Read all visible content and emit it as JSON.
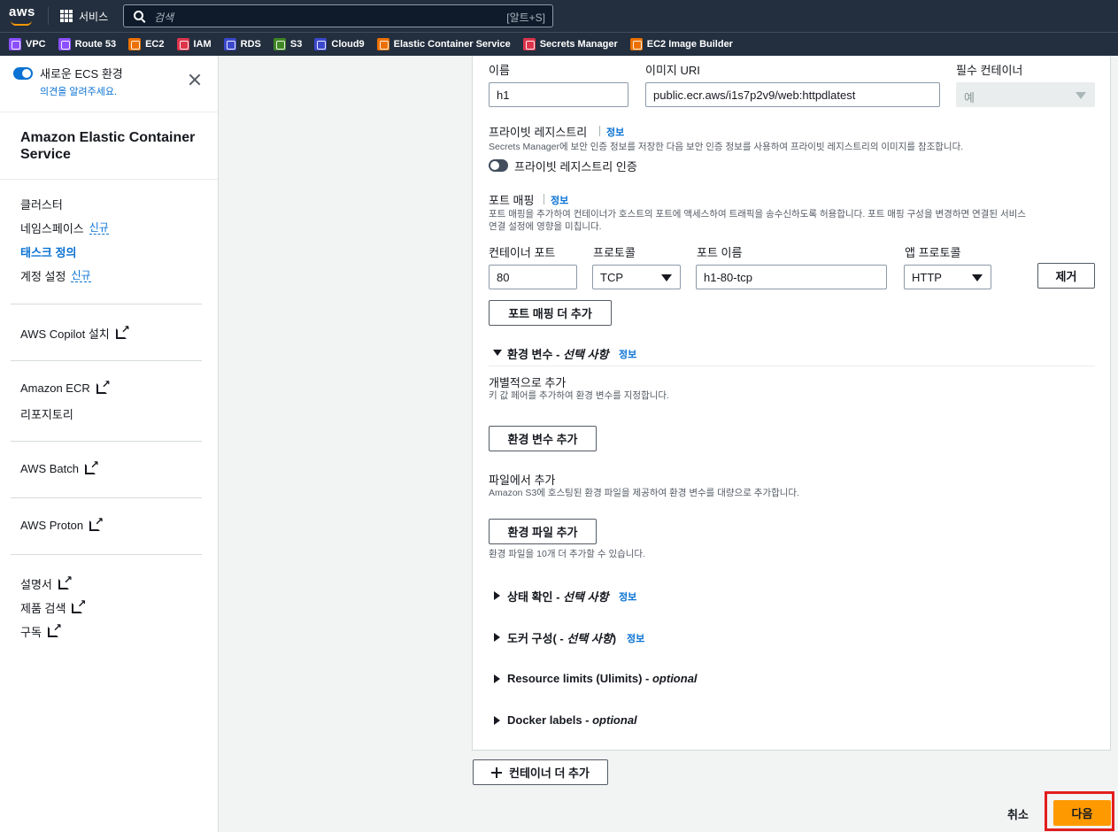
{
  "topnav": {
    "logo": "aws",
    "services_label": "서비스",
    "search_placeholder": "검색",
    "search_shortcut": "[알트+S]"
  },
  "favorites": [
    {
      "label": "VPC",
      "color": "#8c4fff"
    },
    {
      "label": "Route 53",
      "color": "#8c4fff"
    },
    {
      "label": "EC2",
      "color": "#ed7100"
    },
    {
      "label": "IAM",
      "color": "#dd344c"
    },
    {
      "label": "RDS",
      "color": "#3b48cc"
    },
    {
      "label": "S3",
      "color": "#3f8624"
    },
    {
      "label": "Cloud9",
      "color": "#3b48cc"
    },
    {
      "label": "Elastic Container Service",
      "color": "#ed7100"
    },
    {
      "label": "Secrets Manager",
      "color": "#dd344c"
    },
    {
      "label": "EC2 Image Builder",
      "color": "#ed7100"
    }
  ],
  "sidebar": {
    "toggle_title": "새로운 ECS 환경",
    "toggle_sub": "의견을 알려주세요.",
    "title": "Amazon Elastic Container Service",
    "nav": {
      "clusters": "클러스터",
      "namespaces": "네임스페이스",
      "namespaces_badge": "신규",
      "task_definitions": "태스크 정의",
      "account_settings": "계정 설정",
      "account_badge": "신규"
    },
    "copilot": "AWS Copilot 설치",
    "ecr_line1": "Amazon ECR",
    "ecr_line2": "리포지토리",
    "batch": "AWS Batch",
    "proton": "AWS Proton",
    "docs": "설명서",
    "product_search": "제품 검색",
    "subscribe": "구독"
  },
  "form": {
    "name_label": "이름",
    "name_value": "h1",
    "image_label": "이미지 URI",
    "image_value": "public.ecr.aws/i1s7p2v9/web:httpdlatest",
    "essential_label": "필수 컨테이너",
    "essential_value": "예",
    "private_registry_label": "프라이빗 레지스트리",
    "info": "정보",
    "private_registry_desc": "Secrets Manager에 보안 인증 정보를 저장한 다음 보안 인증 정보를 사용하여 프라이빗 레지스트리의 이미지를 참조합니다.",
    "private_registry_toggle": "프라이빗 레지스트리 인증",
    "port_mapping_label": "포트 매핑",
    "port_mapping_desc1": "포트 매핑을 추가하여 컨테이너가 호스트의 포트에 액세스하여 트래픽을 송수신하도록 허용합니다. 포트 매핑 구성을 변경하면 연결된 서비스",
    "port_mapping_desc2": "연결 설정에 영향을 미칩니다.",
    "container_port_label": "컨테이너 포트",
    "container_port_value": "80",
    "protocol_label": "프로토콜",
    "protocol_value": "TCP",
    "port_name_label": "포트 이름",
    "port_name_value": "h1-80-tcp",
    "app_protocol_label": "앱 프로토콜",
    "app_protocol_value": "HTTP",
    "remove_button": "제거",
    "add_port_mapping_button": "포트 매핑 더 추가",
    "env_section_title": "환경 변수 - ",
    "env_section_optional": "선택 사항",
    "add_individually_label": "개별적으로 추가",
    "add_individually_desc": "키 값 페어를 추가하여 환경 변수를 지정합니다.",
    "add_env_button": "환경 변수 추가",
    "add_from_file_label": "파일에서 추가",
    "add_from_file_desc": "Amazon S3에 호스팅된 환경 파일을 제공하여 환경 변수를 대량으로 추가합니다.",
    "add_env_file_button": "환경 파일 추가",
    "env_file_hint": "환경 파일을 10개 더 추가할 수 있습니다.",
    "health_check_title": "상태 확인 - ",
    "health_check_optional": "선택 사항",
    "docker_config_title": "도커 구성( - ",
    "docker_config_optional": "선택 사항",
    "docker_config_close": ")",
    "resource_limits_title": "Resource limits (Ulimits) - ",
    "resource_limits_optional": "optional",
    "docker_labels_title": "Docker labels - ",
    "docker_labels_optional": "optional"
  },
  "footer": {
    "add_container_button": "컨테이너 더 추가",
    "cancel": "취소",
    "next": "다음"
  }
}
